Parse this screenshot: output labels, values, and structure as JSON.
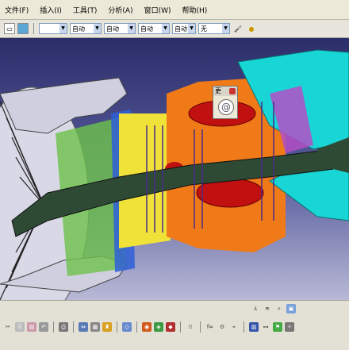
{
  "menu": {
    "items": [
      "文件(F)",
      "插入(I)",
      "工具(T)",
      "分析(A)",
      "窗口(W)",
      "帮助(H)"
    ]
  },
  "toolbar": {
    "color_combo": "",
    "linetype_combo": "自动",
    "thickness_combo": "自动",
    "point_combo": "自动",
    "layer_combo": "自动",
    "layer_name_combo": "无"
  },
  "floating_panel": {
    "title": "更"
  },
  "colors": {
    "viewport_top": "#2c2e6a",
    "viewport_bottom": "#b8b9d6",
    "casing_cyan": "#19d6d6",
    "combustor_red": "#c01010",
    "compressor_orange": "#f07a18",
    "shaft_green": "#2e4a34",
    "fan_gray": "#d8d8e6"
  }
}
